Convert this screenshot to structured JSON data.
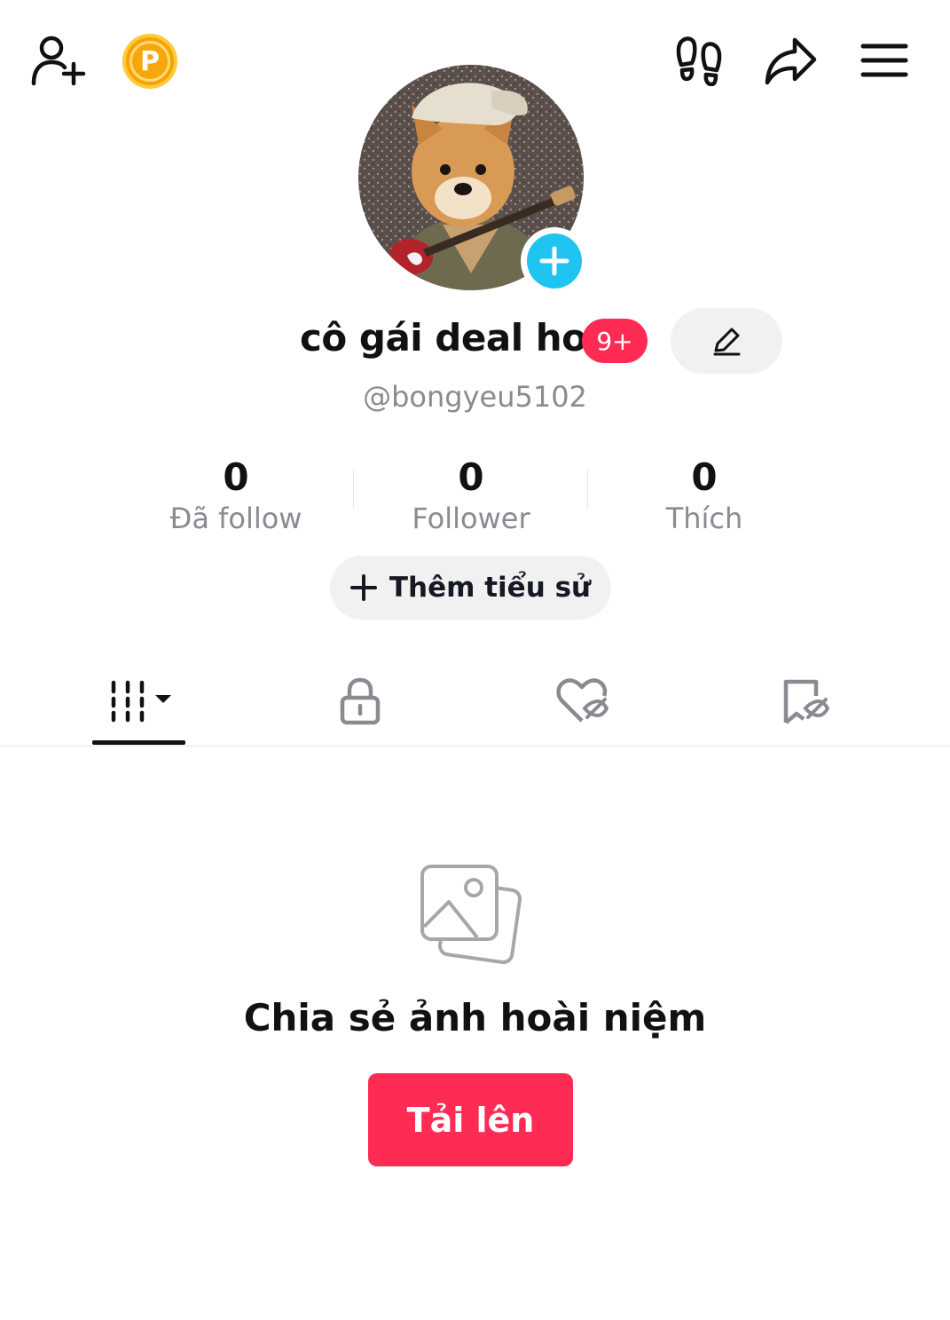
{
  "topbar": {
    "add_friend_icon": "person-plus-icon",
    "coin_icon": "coin-icon",
    "coin_letter": "P",
    "footprint_icon": "footprints-icon",
    "share_icon": "share-arrow-icon",
    "menu_icon": "hamburger-menu-icon"
  },
  "profile": {
    "avatar_icon": "dog-avatar",
    "avatar_add_icon": "plus-icon",
    "name": "cô gái deal hot",
    "badge": "9+",
    "edit_icon": "pencil-icon",
    "handle": "@bongyeu5102"
  },
  "stats": [
    {
      "value": "0",
      "label": "Đã follow"
    },
    {
      "value": "0",
      "label": "Follower"
    },
    {
      "value": "0",
      "label": "Thích"
    }
  ],
  "bio_button": {
    "icon": "plus-icon",
    "label": "Thêm tiểu sử"
  },
  "tabs": [
    {
      "icon": "grid-icon",
      "active": true
    },
    {
      "icon": "lock-icon",
      "active": false
    },
    {
      "icon": "heart-hidden-icon",
      "active": false
    },
    {
      "icon": "bookmark-hidden-icon",
      "active": false
    }
  ],
  "empty_state": {
    "icon": "photos-icon",
    "title": "Chia sẻ ảnh hoài niệm",
    "button_label": "Tải lên"
  },
  "colors": {
    "accent": "#FE2C55",
    "avatar_add": "#20C4F0",
    "coin": "#F6A300",
    "muted_text": "#8A8B91",
    "pill_bg": "#F1F1F2"
  }
}
